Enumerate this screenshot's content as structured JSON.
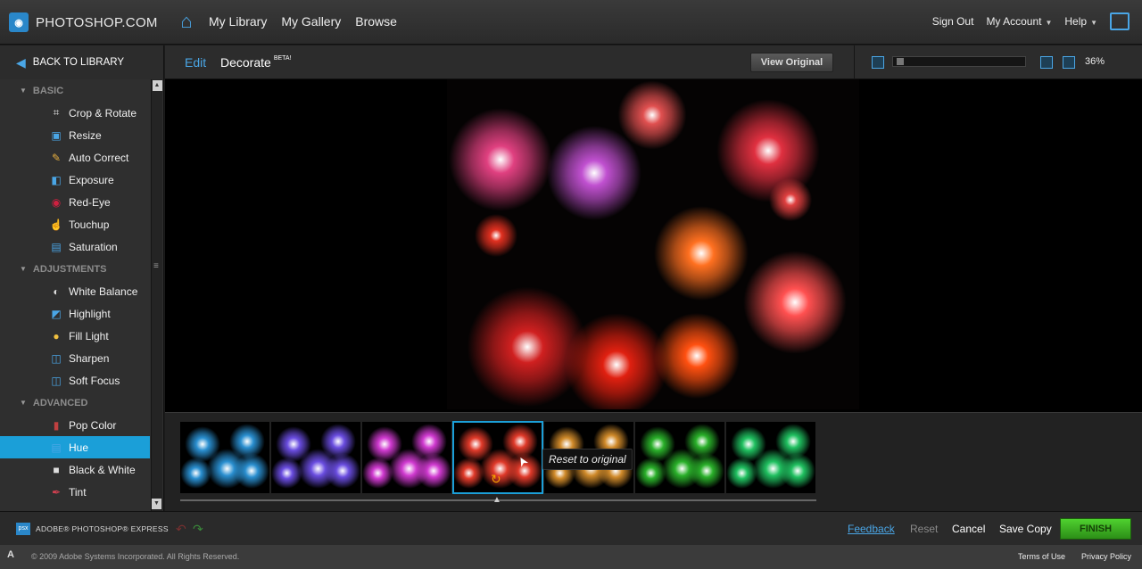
{
  "topbar": {
    "logo_text": "PHOTOSHOP.COM",
    "nav": [
      "My Library",
      "My Gallery",
      "Browse"
    ],
    "sign_out": "Sign Out",
    "my_account": "My Account",
    "help": "Help"
  },
  "subheader": {
    "back_label": "BACK TO LIBRARY",
    "tab_edit": "Edit",
    "tab_decorate": "Decorate",
    "beta": "BETA!",
    "view_original": "View Original",
    "zoom_pct": "36%",
    "zoom_level": 0.02
  },
  "sidebar": {
    "sections": [
      {
        "title": "BASIC",
        "tools": [
          {
            "label": "Crop & Rotate",
            "icon": "crop-icon"
          },
          {
            "label": "Resize",
            "icon": "resize-icon"
          },
          {
            "label": "Auto Correct",
            "icon": "wand-icon"
          },
          {
            "label": "Exposure",
            "icon": "exposure-icon"
          },
          {
            "label": "Red-Eye",
            "icon": "red-eye-icon"
          },
          {
            "label": "Touchup",
            "icon": "touchup-icon"
          },
          {
            "label": "Saturation",
            "icon": "saturation-icon"
          }
        ]
      },
      {
        "title": "ADJUSTMENTS",
        "tools": [
          {
            "label": "White Balance",
            "icon": "white-balance-icon"
          },
          {
            "label": "Highlight",
            "icon": "highlight-icon"
          },
          {
            "label": "Fill Light",
            "icon": "bulb-icon"
          },
          {
            "label": "Sharpen",
            "icon": "sharpen-icon"
          },
          {
            "label": "Soft Focus",
            "icon": "soft-focus-icon"
          }
        ]
      },
      {
        "title": "ADVANCED",
        "tools": [
          {
            "label": "Pop Color",
            "icon": "pop-color-icon"
          },
          {
            "label": "Hue",
            "icon": "hue-icon"
          },
          {
            "label": "Black & White",
            "icon": "black-white-icon"
          },
          {
            "label": "Tint",
            "icon": "tint-icon"
          }
        ]
      }
    ],
    "active_tool": "Hue"
  },
  "filmstrip": {
    "tooltip": "Reset to original",
    "thumb_colors": [
      "#2a8fd0",
      "#6a4de0",
      "#d03ad0",
      "#e03a2a",
      "#d08a2a",
      "#2ab02a",
      "#20c060"
    ],
    "selected_index": 3
  },
  "bottom": {
    "brand_text": "ADOBE® PHOTOSHOP® EXPRESS",
    "brand_icon": "psx",
    "feedback": "Feedback",
    "reset": "Reset",
    "cancel": "Cancel",
    "save_copy": "Save Copy",
    "finish": "FINISH"
  },
  "footer": {
    "copyright": "© 2009 Adobe Systems Incorporated. All Rights Reserved.",
    "terms": "Terms of Use",
    "privacy": "Privacy Policy"
  },
  "colors": {
    "accent": "#1b9fd8",
    "finish_green": "#3bbf22"
  }
}
